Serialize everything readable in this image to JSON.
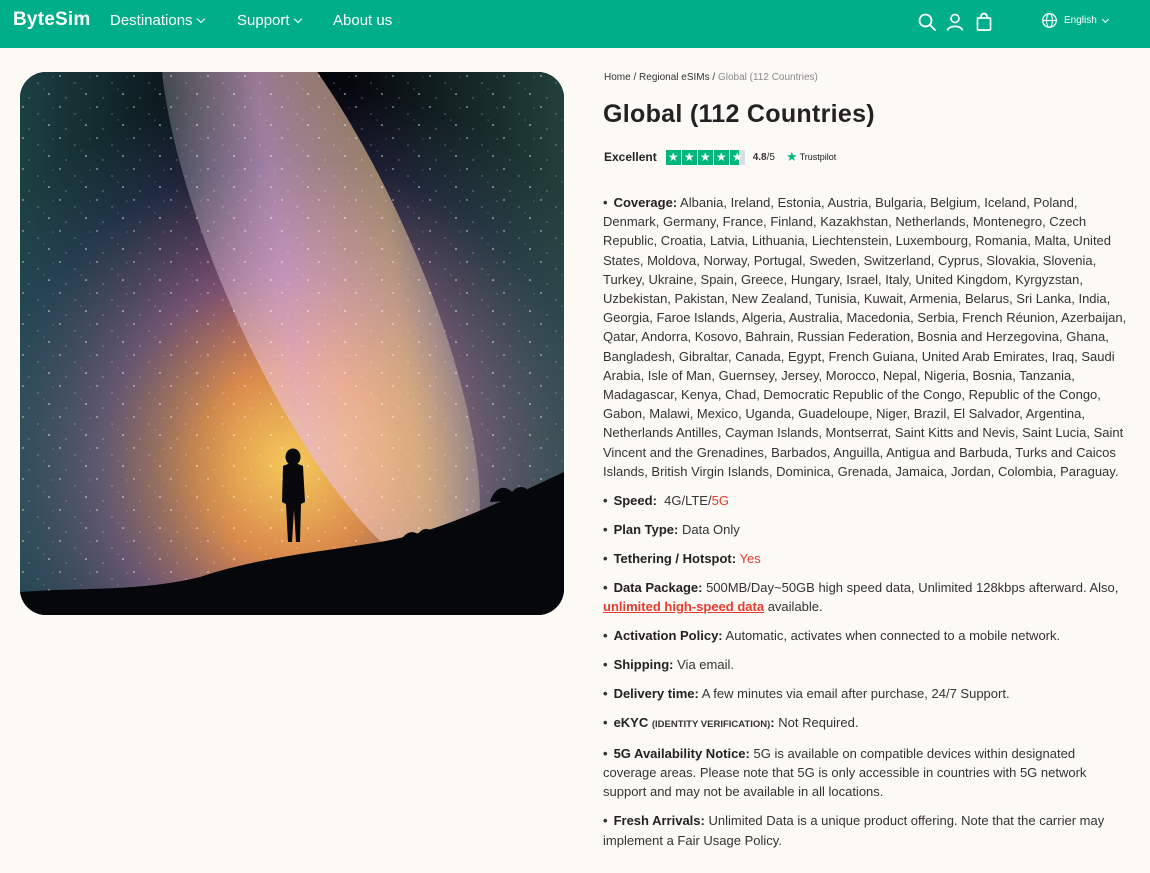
{
  "header": {
    "logo": "ByteSim",
    "nav": [
      {
        "label": "Destinations",
        "has_dropdown": true
      },
      {
        "label": "Support",
        "has_dropdown": true
      },
      {
        "label": "About us",
        "has_dropdown": false
      }
    ],
    "icons": [
      "search-icon",
      "user-icon",
      "cart-icon",
      "globe-icon"
    ],
    "language": "English"
  },
  "hero_image": {
    "subject": "person silhouette under Milky Way night sky"
  },
  "breadcrumb": {
    "home": "Home",
    "sep": "/",
    "section": "Regional eSIMs",
    "current": "Global (112 Countries)"
  },
  "product": {
    "title": "Global (112 Countries)",
    "rating_label": "Excellent",
    "rating_value": "4.8",
    "rating_max": "/5",
    "stars": 4.5,
    "trustpilot": "Trustpilot"
  },
  "specs": {
    "coverage_label": "Coverage:",
    "coverage_value": "Albania, Ireland, Estonia, Austria, Bulgaria, Belgium, Iceland, Poland, Denmark, Germany, France, Finland, Kazakhstan, Netherlands, Montenegro, Czech Republic, Croatia, Latvia, Lithuania, Liechtenstein, Luxembourg, Romania, Malta, United States, Moldova, Norway, Portugal, Sweden, Switzerland, Cyprus, Slovakia, Slovenia, Turkey, Ukraine, Spain, Greece, Hungary, Israel, Italy, United Kingdom, Kyrgyzstan, Uzbekistan, Pakistan, New Zealand, Tunisia, Kuwait, Armenia, Belarus, Sri Lanka, India, Georgia, Faroe Islands, Algeria, Australia, Macedonia, Serbia, French Réunion, Azerbaijan, Qatar, Andorra, Kosovo, Bahrain, Russian Federation, Bosnia and Herzegovina, Ghana, Bangladesh, Gibraltar, Canada, Egypt, French Guiana, United Arab Emirates, Iraq, Saudi Arabia, Isle of Man, Guernsey, Jersey, Morocco, Nepal, Nigeria, Bosnia, Tanzania, Madagascar, Kenya, Chad, Democratic Republic of the Congo, Republic of the Congo, Gabon, Malawi, Mexico, Uganda, Guadeloupe, Niger, Brazil, El Salvador, Argentina, Netherlands Antilles, Cayman Islands, Montserrat, Saint Kitts and Nevis, Saint Lucia, Saint Vincent and the Grenadines, Barbados, Anguilla, Antigua and Barbuda, Turks and Caicos Islands, British Virgin Islands, Dominica, Grenada, Jamaica, Jordan, Colombia, Paraguay.",
    "speed_label": "Speed:",
    "speed_value": "4G/LTE/",
    "speed_5g": "5G",
    "plan_label": "Plan Type:",
    "plan_value": "Data Only",
    "tether_label": "Tethering / Hotspot:",
    "tether_value": "Yes",
    "package_label": "Data Package:",
    "package_value": "500MB/Day~50GB high speed data, Unlimited 128kbps afterward. Also,",
    "package_link": "unlimited high-speed data",
    "package_suffix": "available.",
    "activation_label": "Activation Policy:",
    "activation_value": "Automatic, activates when connected to a mobile network.",
    "shipping_label": "Shipping:",
    "shipping_value": "Via email.",
    "delivery_label": "Delivery time:",
    "delivery_value": "A few minutes via email after purchase, 24/7 Support.",
    "ekyc_label": "eKYC",
    "ekyc_sub": "(IDENTITY VERIFICATION)",
    "ekyc_colon": ":",
    "ekyc_value": "Not Required.",
    "notice_label": "5G Availability Notice:",
    "notice_value": "5G is available on compatible devices within designated coverage areas. Please note that 5G is only accessible in countries with 5G network support and may not be available in all locations.",
    "fresh_label": "Fresh Arrivals:",
    "fresh_value": "Unlimited Data is a unique product offering. Note that the carrier may implement a Fair Usage Policy."
  },
  "colors": {
    "brand": "#00ae8a",
    "accent": "#e83a2f",
    "trustpilot": "#00b67a",
    "background": "#fdfaf6"
  }
}
